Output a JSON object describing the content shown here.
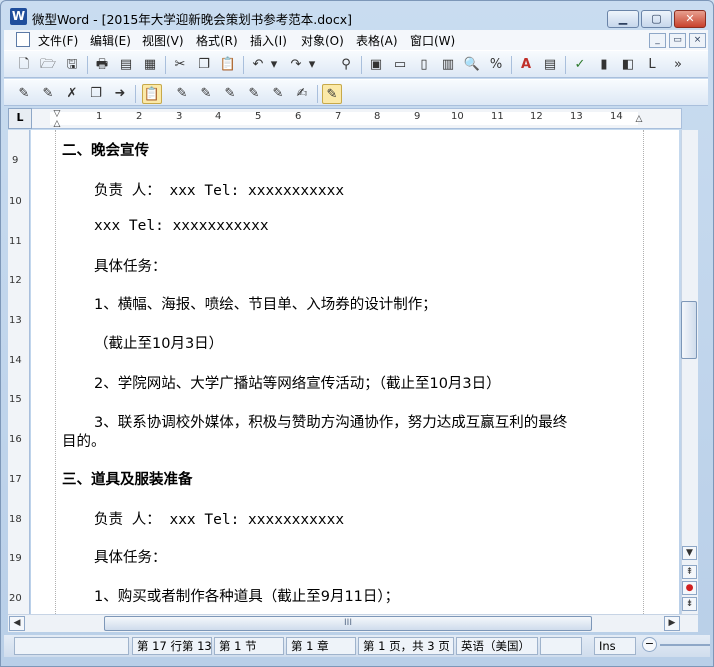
{
  "titlebar": {
    "app_icon_letter": "W",
    "title": "微型Word - [2015年大学迎新晚会策划书参考范本.docx]",
    "minimize": "▁",
    "maximize": "▢",
    "close": "✕"
  },
  "menu": [
    "文件(F)",
    "编辑(E)",
    "视图(V)",
    "格式(R)",
    "插入(I)",
    "对象(O)",
    "表格(A)",
    "窗口(W)"
  ],
  "ruler": {
    "corner": "L",
    "numbers": [
      "1",
      "2",
      "3",
      "4",
      "5",
      "6",
      "7",
      "8",
      "9",
      "10",
      "11",
      "12",
      "13",
      "14"
    ],
    "vertical_numbers": [
      "9",
      "10",
      "11",
      "12",
      "13",
      "14",
      "15",
      "16",
      "17",
      "18",
      "19",
      "20"
    ]
  },
  "document": {
    "lines": [
      {
        "text": "二、晚会宣传",
        "bold": true
      },
      {
        "text": "负责 人： xxx Tel: xxxxxxxxxxx"
      },
      {
        "text": "xxx Tel: xxxxxxxxxxx"
      },
      {
        "text": "具体任务："
      },
      {
        "text": "1、横幅、海报、喷绘、节目单、入场券的设计制作；"
      },
      {
        "text": "（截止至10月3日）"
      },
      {
        "text": "2、学院网站、大学广播站等网络宣传活动；（截止至10月3日）"
      },
      {
        "text": "3、联系协调校外媒体，积极与赞助方沟通协作，努力达成互赢互利的最终"
      },
      {
        "text": "目的。"
      },
      {
        "text": "三、道具及服装准备",
        "bold": true
      },
      {
        "text": "负责 人： xxx Tel: xxxxxxxxxxx"
      },
      {
        "text": "具体任务："
      },
      {
        "text": "1、购买或者制作各种道具（截止至9月11日）；"
      }
    ]
  },
  "scroll": {
    "hthumb_grip": "III"
  },
  "status": {
    "line_col": "第 17 行第 13",
    "section": "第 1 节",
    "chapter": "第 1 章",
    "page": "第 1 页，共 3 页",
    "language": "英语（美国）",
    "mode": "Ins",
    "zoom_minus": "−"
  },
  "colors": {
    "title_bar": "#c9dcf0",
    "page": "#ffffff",
    "close_button": "#c8412c"
  }
}
